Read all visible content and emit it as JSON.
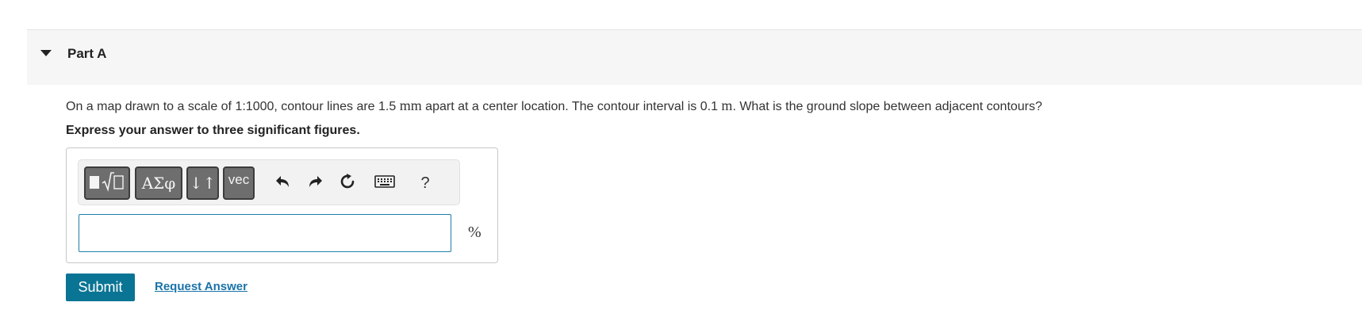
{
  "part": {
    "title": "Part A"
  },
  "question": {
    "text_1": "On a map drawn to a scale of 1:1000, contour lines are 1.5 ",
    "unit_1": "mm",
    "text_2": " apart at a center location. The contour interval is 0.1 ",
    "unit_2": "m",
    "text_3": ". What is the ground slope between adjacent contours?",
    "instruction": "Express your answer to three significant figures."
  },
  "toolbar": {
    "templates_label": "▮√▯",
    "greek_label": "ΑΣφ",
    "arrows_label": "↓↑",
    "vec_label": "vec",
    "help_label": "?",
    "icons": [
      "templates-icon",
      "greek-letters-icon",
      "arrows-icon",
      "vector-icon",
      "undo-icon",
      "redo-icon",
      "reset-icon",
      "keyboard-icon",
      "help-icon"
    ]
  },
  "answer": {
    "value": "",
    "placeholder": "",
    "unit": "%"
  },
  "actions": {
    "submit_label": "Submit",
    "request_label": "Request Answer"
  },
  "colors": {
    "accent": "#0a7494",
    "link": "#1a73a8",
    "input_border": "#1f7fa8",
    "header_bg": "#f6f6f6"
  }
}
